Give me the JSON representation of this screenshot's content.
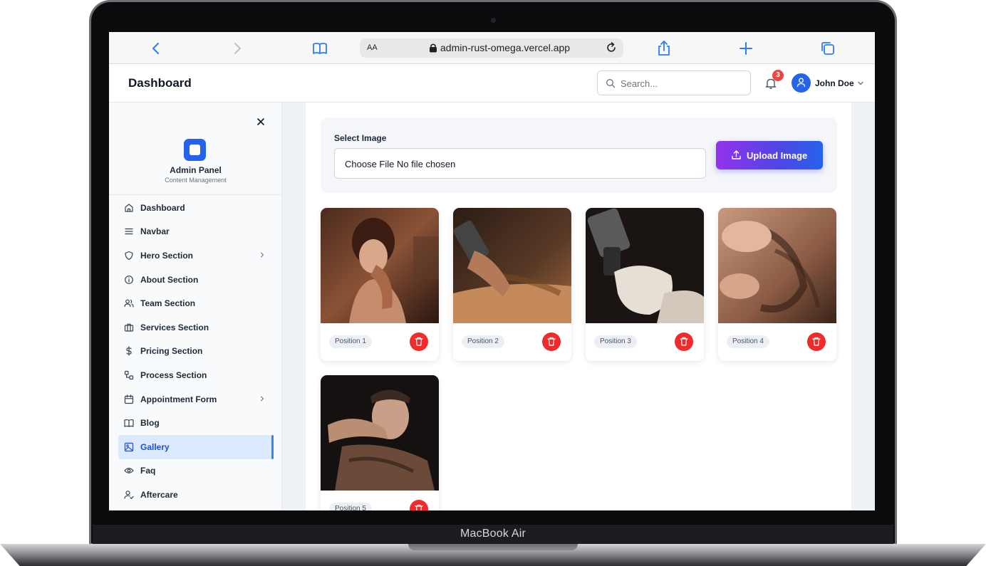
{
  "device": {
    "label": "MacBook Air"
  },
  "browser": {
    "text_size_label": "AA",
    "url": "admin-rust-omega.vercel.app"
  },
  "header": {
    "title": "Dashboard",
    "search_placeholder": "Search...",
    "notification_count": "3",
    "user_name": "John Doe"
  },
  "sidebar": {
    "brand_name": "Admin Panel",
    "brand_subtitle": "Content Management",
    "items": [
      {
        "label": "Dashboard",
        "icon": "home-icon"
      },
      {
        "label": "Navbar",
        "icon": "menu-icon"
      },
      {
        "label": "Hero Section",
        "icon": "shield-icon",
        "has_submenu": true
      },
      {
        "label": "About Section",
        "icon": "info-icon"
      },
      {
        "label": "Team Section",
        "icon": "users-icon"
      },
      {
        "label": "Services Section",
        "icon": "briefcase-icon"
      },
      {
        "label": "Pricing Section",
        "icon": "dollar-icon"
      },
      {
        "label": "Process Section",
        "icon": "process-icon"
      },
      {
        "label": "Appointment Form",
        "icon": "calendar-icon",
        "has_submenu": true
      },
      {
        "label": "Blog",
        "icon": "book-icon"
      },
      {
        "label": "Gallery",
        "icon": "image-icon",
        "active": true
      },
      {
        "label": "Faq",
        "icon": "eye-icon"
      },
      {
        "label": "Aftercare",
        "icon": "user-check-icon"
      }
    ]
  },
  "upload": {
    "label": "Select Image",
    "file_input_text": "Choose File No file chosen",
    "button_label": "Upload Image"
  },
  "gallery": {
    "items": [
      {
        "position_label": "Position 1"
      },
      {
        "position_label": "Position 2"
      },
      {
        "position_label": "Position 3"
      },
      {
        "position_label": "Position 4"
      },
      {
        "position_label": "Position 5"
      }
    ]
  },
  "colors": {
    "primary": "#2563eb",
    "active_bg": "#dbeafe",
    "danger": "#ef2b2b",
    "gradient_start": "#9333ea",
    "gradient_end": "#2563eb"
  }
}
